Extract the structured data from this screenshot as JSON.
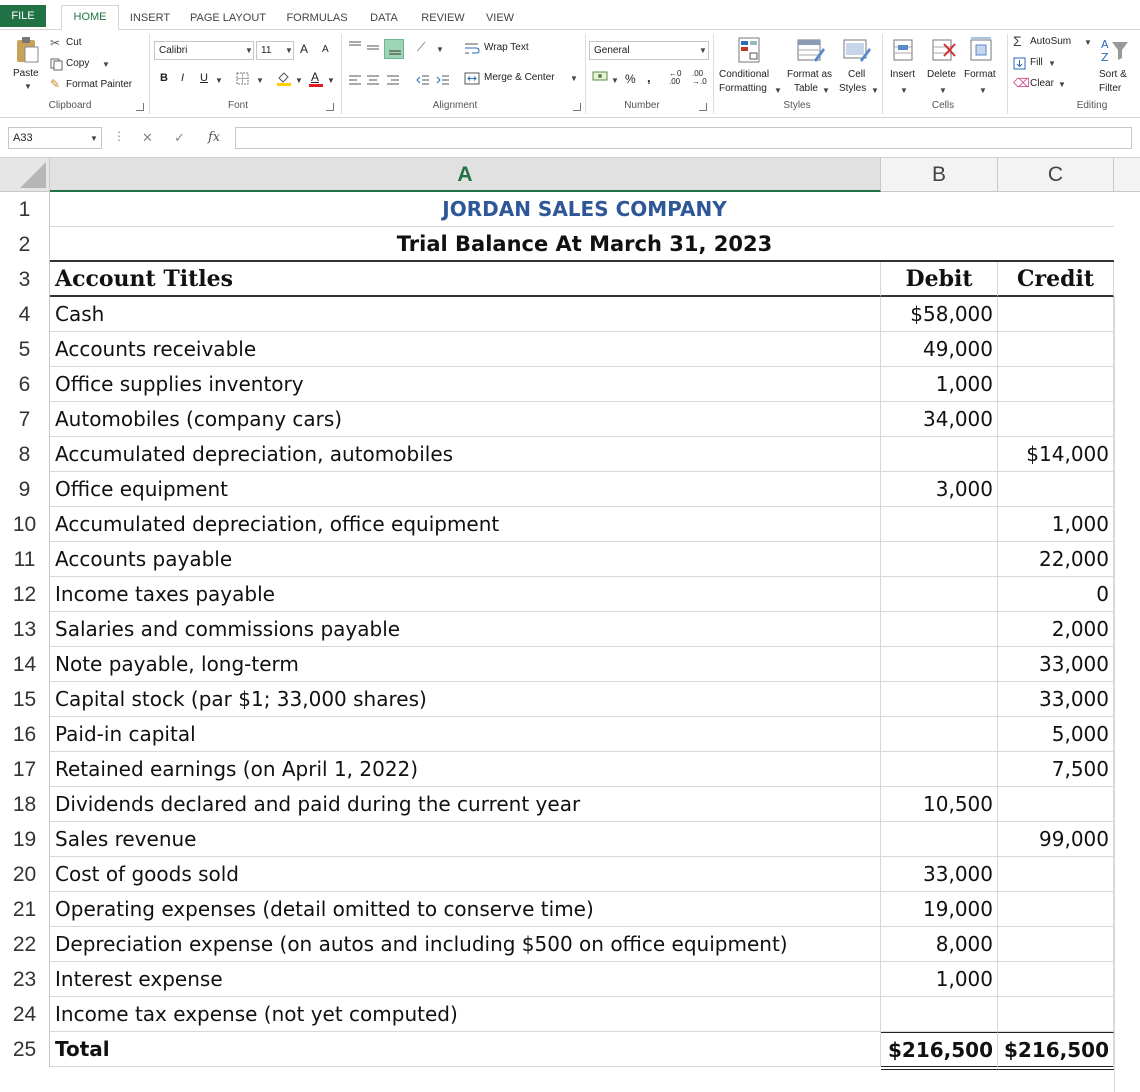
{
  "ribbon": {
    "tabs": [
      "FILE",
      "HOME",
      "INSERT",
      "PAGE LAYOUT",
      "FORMULAS",
      "DATA",
      "REVIEW",
      "VIEW"
    ],
    "clipboard": {
      "paste": "Paste",
      "cut": "Cut",
      "copy": "Copy",
      "format_painter": "Format Painter",
      "label": "Clipboard"
    },
    "font": {
      "name": "Calibri",
      "size": "11",
      "bold": "B",
      "italic": "I",
      "underline": "U",
      "grow": "A",
      "shrink": "A",
      "label": "Font"
    },
    "alignment": {
      "wrap": "Wrap Text",
      "merge": "Merge & Center",
      "label": "Alignment"
    },
    "number": {
      "format": "General",
      "percent": "%",
      "comma": ",",
      "label": "Number"
    },
    "styles": {
      "conditional": "Conditional",
      "conditional2": "Formatting",
      "format_as": "Format as",
      "format_as2": "Table",
      "cell": "Cell",
      "cell2": "Styles",
      "label": "Styles"
    },
    "cells": {
      "insert": "Insert",
      "delete": "Delete",
      "format": "Format",
      "label": "Cells"
    },
    "editing": {
      "autosum": "AutoSum",
      "fill": "Fill",
      "clear": "Clear",
      "sort": "Sort &",
      "filter": "Filter",
      "label": "Editing"
    }
  },
  "formula_bar": {
    "name_box": "A33",
    "fx": "fx",
    "value": ""
  },
  "columns": [
    "A",
    "B",
    "C"
  ],
  "selected_column": "A",
  "sheet": {
    "title": "JORDAN SALES COMPANY",
    "subtitle": "Trial Balance At March 31, 2023",
    "headers": {
      "account": "Account Titles",
      "debit": "Debit",
      "credit": "Credit"
    },
    "rows": [
      {
        "n": "4",
        "account": "Cash",
        "debit": "$58,000",
        "credit": ""
      },
      {
        "n": "5",
        "account": "Accounts receivable",
        "debit": "49,000",
        "credit": ""
      },
      {
        "n": "6",
        "account": "Office supplies inventory",
        "debit": "1,000",
        "credit": ""
      },
      {
        "n": "7",
        "account": "Automobiles (company cars)",
        "debit": "34,000",
        "credit": ""
      },
      {
        "n": "8",
        "account": "Accumulated depreciation, automobiles",
        "debit": "",
        "credit": "$14,000"
      },
      {
        "n": "9",
        "account": "Office equipment",
        "debit": "3,000",
        "credit": ""
      },
      {
        "n": "10",
        "account": "Accumulated depreciation, office equipment",
        "debit": "",
        "credit": "1,000"
      },
      {
        "n": "11",
        "account": "Accounts payable",
        "debit": "",
        "credit": "22,000"
      },
      {
        "n": "12",
        "account": "Income taxes payable",
        "debit": "",
        "credit": "0"
      },
      {
        "n": "13",
        "account": "Salaries and commissions payable",
        "debit": "",
        "credit": "2,000"
      },
      {
        "n": "14",
        "account": "Note payable, long-term",
        "debit": "",
        "credit": "33,000"
      },
      {
        "n": "15",
        "account": "Capital stock (par $1; 33,000 shares)",
        "debit": "",
        "credit": "33,000"
      },
      {
        "n": "16",
        "account": "Paid-in capital",
        "debit": "",
        "credit": "5,000"
      },
      {
        "n": "17",
        "account": "Retained earnings (on April 1, 2022)",
        "debit": "",
        "credit": "7,500"
      },
      {
        "n": "18",
        "account": "Dividends declared and paid during the current year",
        "debit": "10,500",
        "credit": ""
      },
      {
        "n": "19",
        "account": "Sales revenue",
        "debit": "",
        "credit": "99,000"
      },
      {
        "n": "20",
        "account": "Cost of goods sold",
        "debit": "33,000",
        "credit": ""
      },
      {
        "n": "21",
        "account": "Operating expenses (detail omitted to conserve time)",
        "debit": "19,000",
        "credit": ""
      },
      {
        "n": "22",
        "account": "Depreciation expense (on autos and including $500  on office equipment)",
        "debit": "8,000",
        "credit": ""
      },
      {
        "n": "23",
        "account": "Interest expense",
        "debit": "1,000",
        "credit": ""
      },
      {
        "n": "24",
        "account": "Income tax expense (not yet computed)",
        "debit": "",
        "credit": ""
      }
    ],
    "total": {
      "n": "25",
      "label": "Total",
      "debit": "$216,500",
      "credit": "$216,500"
    }
  }
}
